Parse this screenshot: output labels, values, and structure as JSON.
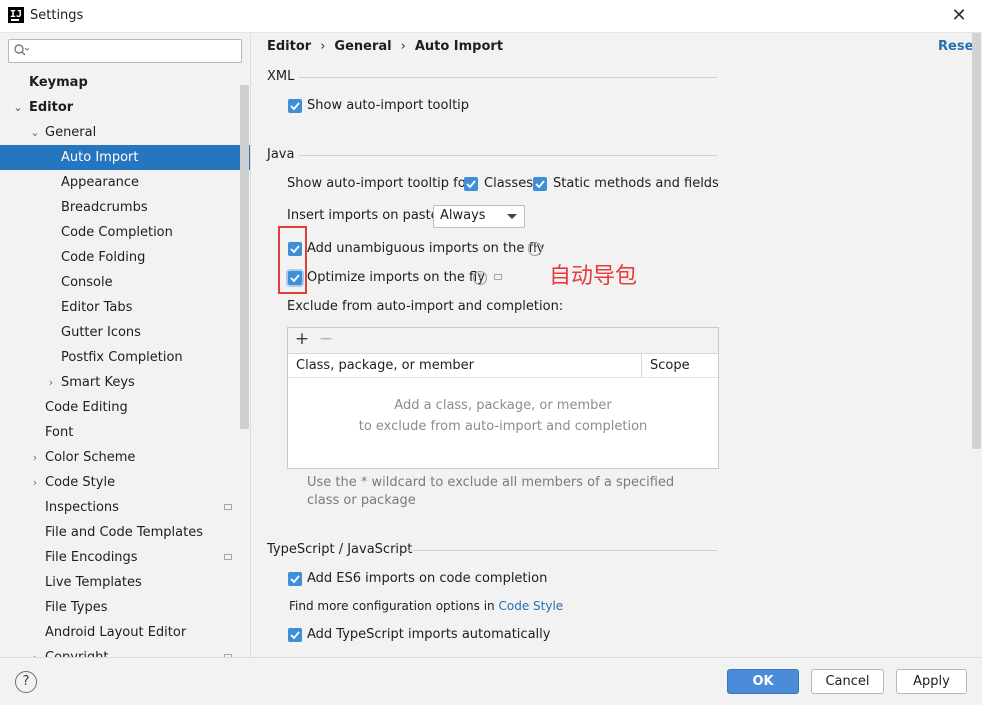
{
  "window": {
    "title": "Settings",
    "logo_text": "IJ",
    "close_glyph": "✕"
  },
  "search": {
    "value": "",
    "placeholder": "",
    "icon": "search-icon"
  },
  "sidebar": {
    "items": [
      {
        "label": "Keymap",
        "level": 0,
        "bold": true,
        "arrow": "",
        "selected": false,
        "badge": false
      },
      {
        "label": "Editor",
        "level": 0,
        "bold": true,
        "arrow": "⌄",
        "selected": false,
        "badge": false
      },
      {
        "label": "General",
        "level": 1,
        "bold": false,
        "arrow": "⌄",
        "selected": false,
        "badge": false
      },
      {
        "label": "Auto Import",
        "level": 2,
        "bold": false,
        "arrow": "",
        "selected": true,
        "badge": false
      },
      {
        "label": "Appearance",
        "level": 2,
        "bold": false,
        "arrow": "",
        "selected": false,
        "badge": false
      },
      {
        "label": "Breadcrumbs",
        "level": 2,
        "bold": false,
        "arrow": "",
        "selected": false,
        "badge": false
      },
      {
        "label": "Code Completion",
        "level": 2,
        "bold": false,
        "arrow": "",
        "selected": false,
        "badge": false
      },
      {
        "label": "Code Folding",
        "level": 2,
        "bold": false,
        "arrow": "",
        "selected": false,
        "badge": false
      },
      {
        "label": "Console",
        "level": 2,
        "bold": false,
        "arrow": "",
        "selected": false,
        "badge": false
      },
      {
        "label": "Editor Tabs",
        "level": 2,
        "bold": false,
        "arrow": "",
        "selected": false,
        "badge": false
      },
      {
        "label": "Gutter Icons",
        "level": 2,
        "bold": false,
        "arrow": "",
        "selected": false,
        "badge": false
      },
      {
        "label": "Postfix Completion",
        "level": 2,
        "bold": false,
        "arrow": "",
        "selected": false,
        "badge": false
      },
      {
        "label": "Smart Keys",
        "level": 2,
        "bold": false,
        "arrow": "›",
        "selected": false,
        "badge": false
      },
      {
        "label": "Code Editing",
        "level": 1,
        "bold": false,
        "arrow": "",
        "selected": false,
        "badge": false
      },
      {
        "label": "Font",
        "level": 1,
        "bold": false,
        "arrow": "",
        "selected": false,
        "badge": false
      },
      {
        "label": "Color Scheme",
        "level": 1,
        "bold": false,
        "arrow": "›",
        "selected": false,
        "badge": false
      },
      {
        "label": "Code Style",
        "level": 1,
        "bold": false,
        "arrow": "›",
        "selected": false,
        "badge": false
      },
      {
        "label": "Inspections",
        "level": 1,
        "bold": false,
        "arrow": "",
        "selected": false,
        "badge": true
      },
      {
        "label": "File and Code Templates",
        "level": 1,
        "bold": false,
        "arrow": "",
        "selected": false,
        "badge": false
      },
      {
        "label": "File Encodings",
        "level": 1,
        "bold": false,
        "arrow": "",
        "selected": false,
        "badge": true
      },
      {
        "label": "Live Templates",
        "level": 1,
        "bold": false,
        "arrow": "",
        "selected": false,
        "badge": false
      },
      {
        "label": "File Types",
        "level": 1,
        "bold": false,
        "arrow": "",
        "selected": false,
        "badge": false
      },
      {
        "label": "Android Layout Editor",
        "level": 1,
        "bold": false,
        "arrow": "",
        "selected": false,
        "badge": false
      },
      {
        "label": "Copyright",
        "level": 1,
        "bold": false,
        "arrow": "›",
        "selected": false,
        "badge": true
      }
    ]
  },
  "breadcrumb": {
    "items": [
      "Editor",
      "General",
      "Auto Import"
    ],
    "separator": "›"
  },
  "reset_label": "Reset",
  "xml": {
    "title": "XML",
    "show_tooltip": {
      "label": "Show auto-import tooltip",
      "checked": true
    }
  },
  "java": {
    "title": "Java",
    "tooltip_for_label": "Show auto-import tooltip for:",
    "classes": {
      "label": "Classes",
      "checked": true
    },
    "static_methods": {
      "label": "Static methods and fields",
      "checked": true
    },
    "insert_on_paste_label": "Insert imports on paste:",
    "insert_on_paste_value": "Always",
    "add_unambiguous": {
      "label": "Add unambiguous imports on the fly",
      "checked": true
    },
    "optimize_imports": {
      "label": "Optimize imports on the fly",
      "checked": true
    },
    "exclude_label": "Exclude from auto-import and completion:",
    "table": {
      "add_glyph": "+",
      "remove_glyph": "−",
      "columns": [
        "Class, package, or member",
        "Scope"
      ],
      "empty_line1": "Add a class, package, or member",
      "empty_line2": "to exclude from auto-import and completion"
    },
    "wildcard_hint": "Use the * wildcard to exclude all members of a specified class or package"
  },
  "annotation_text": "自动导包",
  "typescript": {
    "title": "TypeScript / JavaScript",
    "es6_imports": {
      "label": "Add ES6 imports on code completion",
      "checked": true
    },
    "more_options_prefix": "Find more configuration options in",
    "more_options_link": "Code Style",
    "ts_imports": {
      "label": "Add TypeScript imports automatically",
      "checked": true
    }
  },
  "buttons": {
    "help": "?",
    "ok": "OK",
    "cancel": "Cancel",
    "apply": "Apply"
  },
  "colors": {
    "accent": "#2675bf",
    "checkbox": "#3d8fd8",
    "annotation": "#e53b3b",
    "link": "#2470b3"
  }
}
